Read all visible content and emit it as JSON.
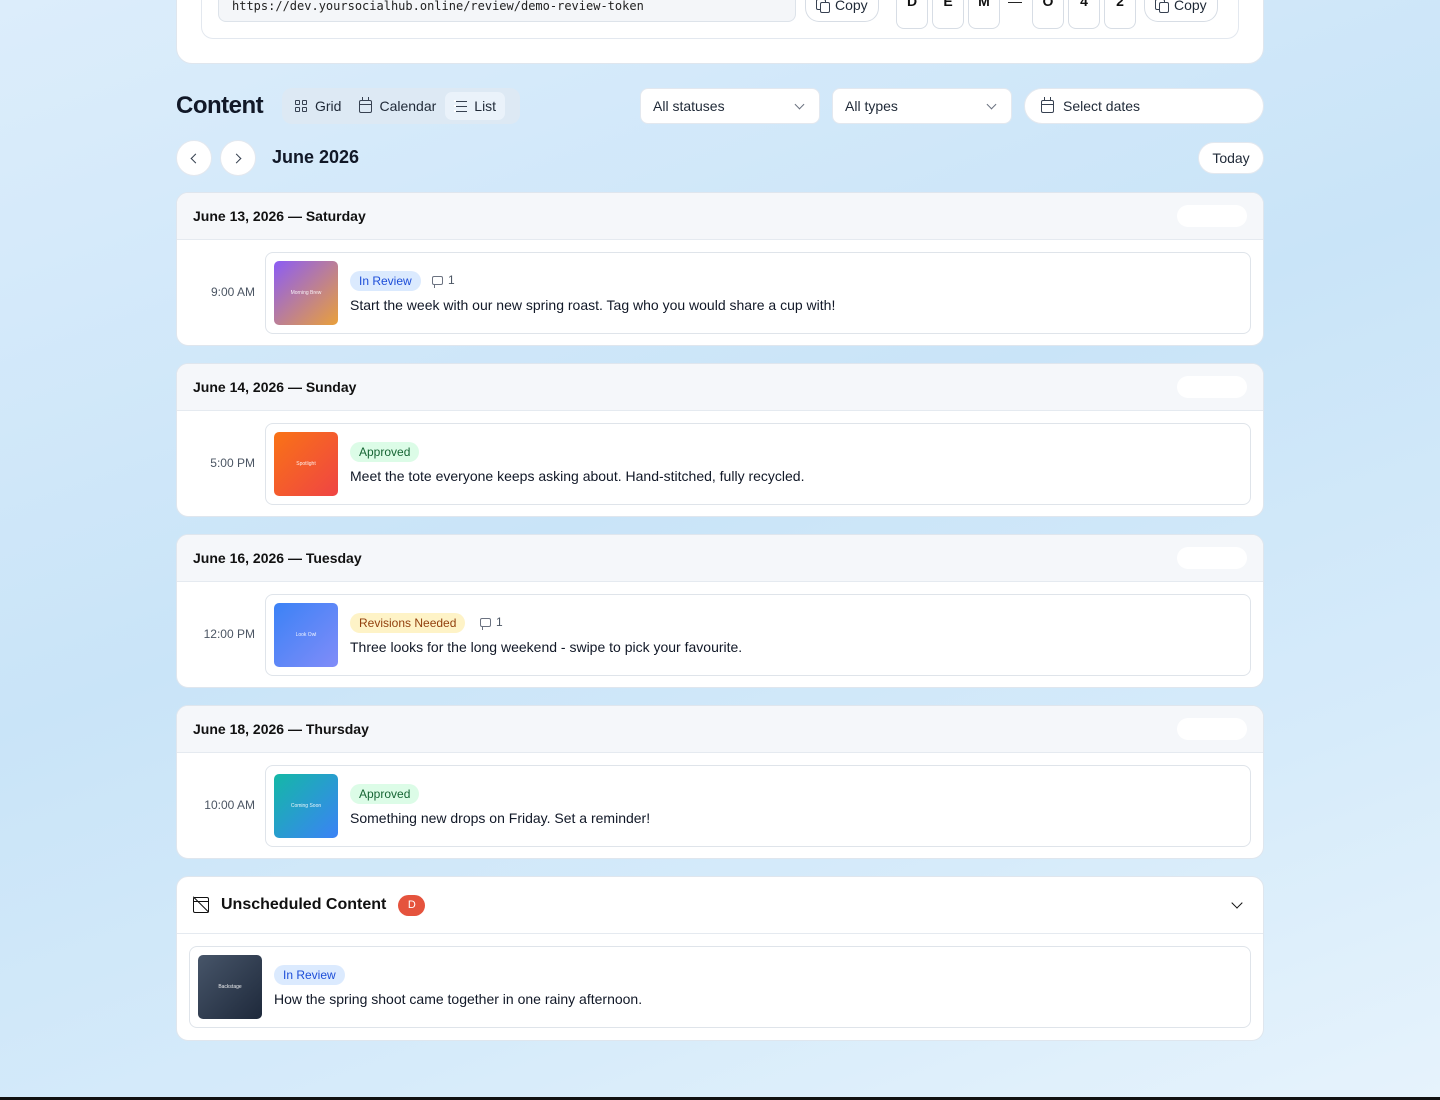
{
  "share": {
    "url": "https://dev.yoursocialhub.online/review/demo-review-token",
    "copy_label": "Copy",
    "code_chars": [
      "D",
      "E",
      "M",
      "—",
      "O",
      "4",
      "2"
    ]
  },
  "toolbar": {
    "title": "Content",
    "views": [
      {
        "label": "Grid",
        "icon": "grid-icon"
      },
      {
        "label": "Calendar",
        "icon": "calendar-icon"
      },
      {
        "label": "List",
        "icon": "list-icon",
        "active": true
      }
    ],
    "status_filter": "All statuses",
    "type_filter": "All types",
    "date_filter": "Select dates"
  },
  "month_nav": {
    "month": "June 2026",
    "today_label": "Today"
  },
  "days": [
    {
      "date": "June 13, 2026 — Saturday",
      "post": {
        "time": "9:00 AM",
        "status": "In Review",
        "comments": "1",
        "caption": "Start the week with our new spring roast. Tag who you would share a cup with!",
        "thumb_label": "Morning Brew",
        "thumb_colors": [
          "#8b5cf6",
          "#e9a03a"
        ]
      }
    },
    {
      "date": "June 14, 2026 — Sunday",
      "post": {
        "time": "5:00 PM",
        "status": "Approved",
        "comments": "",
        "caption": "Meet the tote everyone keeps asking about. Hand-stitched, fully recycled.",
        "thumb_label": "Spotlight",
        "thumb_colors": [
          "#f97316",
          "#ef4444"
        ]
      }
    },
    {
      "date": "June 16, 2026 — Tuesday",
      "post": {
        "time": "12:00 PM",
        "status": "Revisions Needed",
        "comments": "1",
        "caption": "Three looks for the long weekend - swipe to pick your favourite.",
        "thumb_label": "Look Owl",
        "thumb_colors": [
          "#3b82f6",
          "#818cf8"
        ]
      }
    },
    {
      "date": "June 18, 2026 — Thursday",
      "post": {
        "time": "10:00 AM",
        "status": "Approved",
        "comments": "",
        "caption": "Something new drops on Friday. Set a reminder!",
        "thumb_label": "Coming Soon",
        "thumb_colors": [
          "#14b8a6",
          "#3b82f6"
        ]
      }
    }
  ],
  "unscheduled": {
    "title": "Unscheduled Content",
    "count": "D",
    "post": {
      "status": "In Review",
      "caption": "How the spring shoot came together in one rainy afternoon.",
      "thumb_label": "Backstage",
      "thumb_colors": [
        "#475569",
        "#1e293b"
      ]
    }
  }
}
